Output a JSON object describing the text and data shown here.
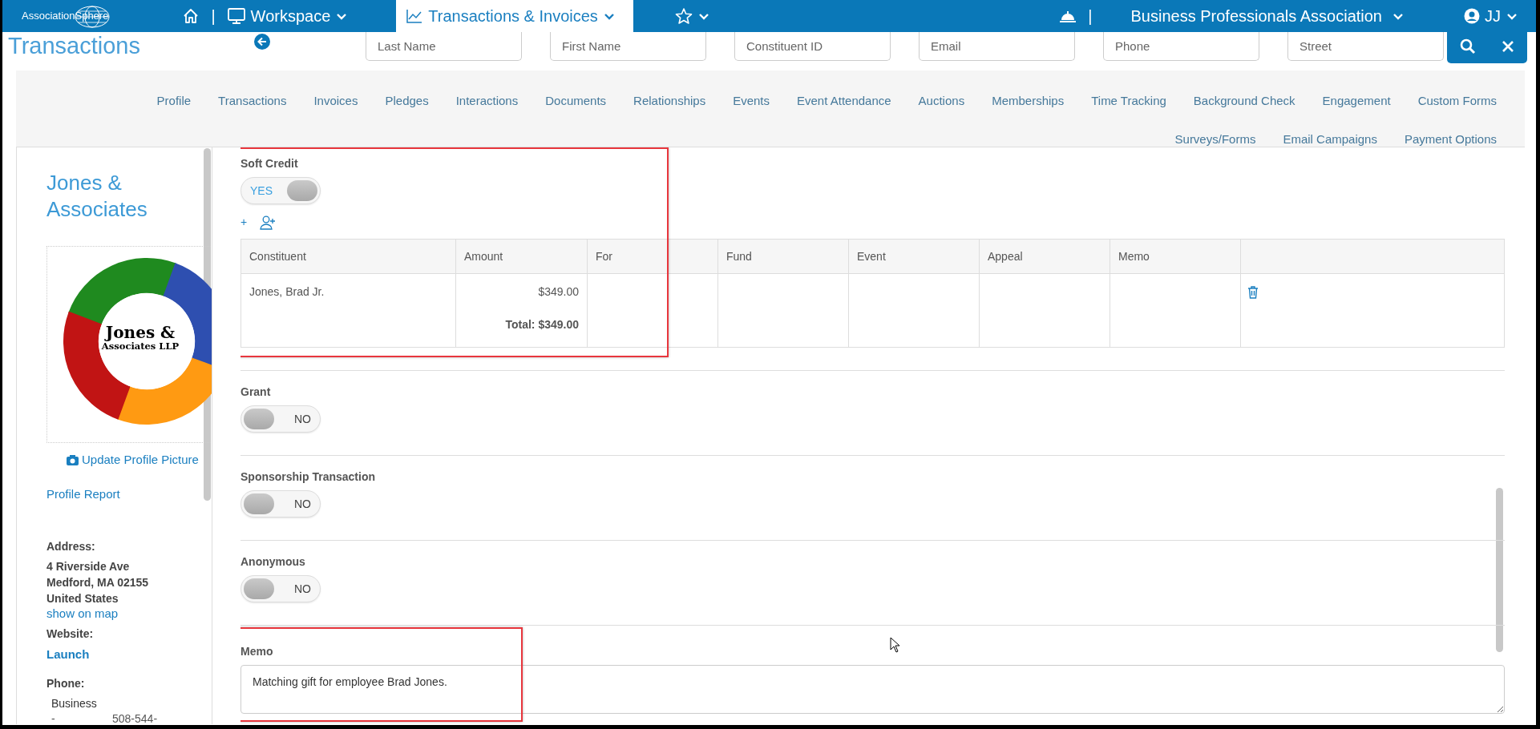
{
  "top_bar": {
    "logo": "AssociationSphere",
    "menus": [
      {
        "label": "Workspace",
        "selected": false
      },
      {
        "label": "Transactions & Invoices",
        "selected": true
      }
    ],
    "divider": "|",
    "organization": "Business Professionals Association",
    "user": "JJ"
  },
  "page_title": "Transactions",
  "search_fields": [
    {
      "placeholder": "Last Name"
    },
    {
      "placeholder": "First Name"
    },
    {
      "placeholder": "Constituent ID"
    },
    {
      "placeholder": "Email"
    },
    {
      "placeholder": "Phone"
    },
    {
      "placeholder": "Street"
    }
  ],
  "profile_tabs": [
    [
      {
        "label": "Profile",
        "selected": false
      },
      {
        "label": "Transactions",
        "selected": false
      },
      {
        "label": "Invoices",
        "selected": false
      },
      {
        "label": "Pledges",
        "selected": false
      },
      {
        "label": "Interactions",
        "selected": false
      },
      {
        "label": "Documents",
        "selected": false
      },
      {
        "label": "Relationships",
        "selected": false
      },
      {
        "label": "Events",
        "selected": false
      },
      {
        "label": "Event Attendance",
        "selected": false
      },
      {
        "label": "Auctions",
        "selected": false
      },
      {
        "label": "Memberships",
        "selected": false
      },
      {
        "label": "Time Tracking",
        "selected": false
      },
      {
        "label": "Background Check",
        "selected": false
      },
      {
        "label": "Engagement",
        "selected": false
      },
      {
        "label": "Custom Forms",
        "selected": false
      }
    ],
    [
      {
        "label": "Surveys/Forms",
        "selected": false
      },
      {
        "label": "Email Campaigns",
        "selected": false
      },
      {
        "label": "Payment Options",
        "selected": false
      }
    ]
  ],
  "sidebar": {
    "name": "Jones & Associates",
    "logo_lines": [
      "Jones &",
      "Associates LLP"
    ],
    "update_picture": "Update Profile Picture",
    "profile_report": "Profile Report",
    "address": {
      "label": "Address:",
      "lines": [
        "4 Riverside Ave",
        "Medford, MA 02155",
        "United States"
      ],
      "map_link": "show on map"
    },
    "website": {
      "label": "Website:",
      "link": "Launch"
    },
    "phone": {
      "label": "Phone:",
      "type": "Business",
      "dash": "-",
      "number": "508-544-"
    }
  },
  "sections": [
    {
      "kind": "toggle",
      "label": "Soft Credit",
      "on": true,
      "toggle_text": "YES",
      "highlighted": true,
      "table": {
        "add": "+",
        "columns": [
          "Constituent",
          "Amount",
          "For",
          "Fund",
          "Event",
          "Appeal",
          "Memo"
        ],
        "rows": [
          {
            "constituent": "Jones, Brad Jr.",
            "amount": "$349.00"
          }
        ],
        "total": "Total: $349.00"
      }
    },
    {
      "kind": "toggle",
      "label": "Grant",
      "on": false,
      "toggle_text": "NO",
      "highlighted": false
    },
    {
      "kind": "toggle",
      "label": "Sponsorship Transaction",
      "on": false,
      "toggle_text": "NO",
      "highlighted": false
    },
    {
      "kind": "toggle",
      "label": "Anonymous",
      "on": false,
      "toggle_text": "NO",
      "highlighted": false
    },
    {
      "kind": "textarea",
      "label": "Memo",
      "value": "Matching gift for employee Brad Jones.",
      "highlighted": true
    }
  ]
}
